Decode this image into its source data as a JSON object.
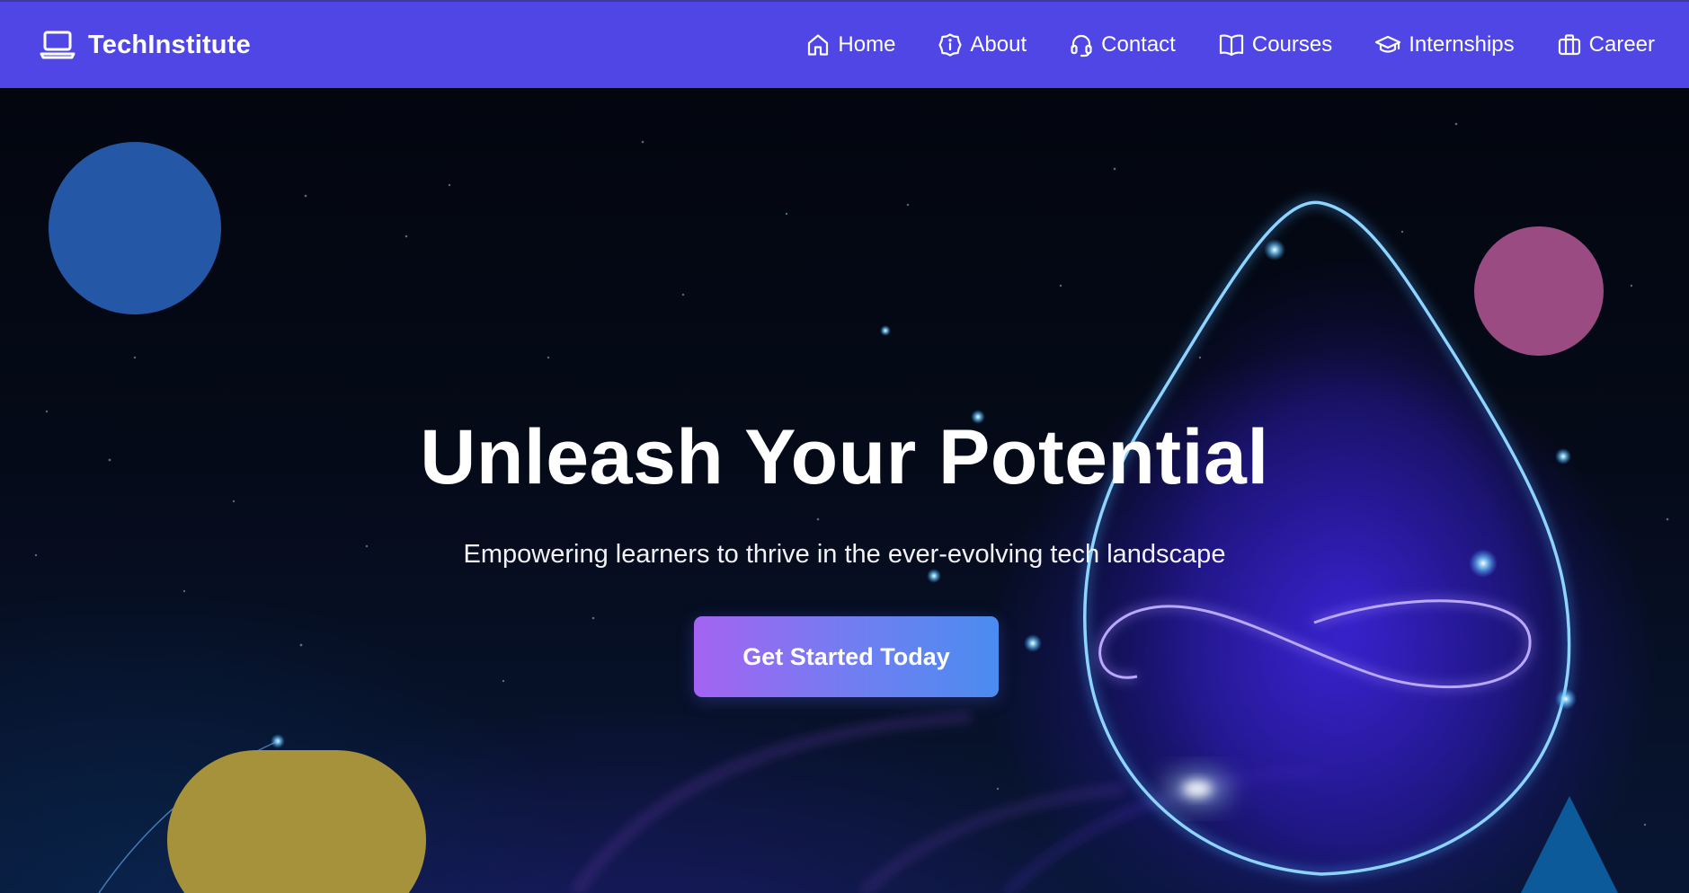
{
  "brand": {
    "name": "TechInstitute",
    "icon": "laptop-icon"
  },
  "nav": {
    "items": [
      {
        "label": "Home",
        "icon": "home-icon"
      },
      {
        "label": "About",
        "icon": "info-icon"
      },
      {
        "label": "Contact",
        "icon": "headset-icon"
      },
      {
        "label": "Courses",
        "icon": "book-icon"
      },
      {
        "label": "Internships",
        "icon": "graduation-cap-icon"
      },
      {
        "label": "Career",
        "icon": "briefcase-icon"
      }
    ]
  },
  "hero": {
    "title": "Unleash Your Potential",
    "subtitle": "Empowering learners to thrive in the ever-evolving tech landscape",
    "cta_label": "Get Started Today"
  },
  "colors": {
    "navbar": "#4f46e5",
    "cta_start": "#a463f2",
    "cta_end": "#4b8cf0",
    "circle_blue": "#2457a6",
    "circle_pink": "#9a4c82",
    "pill_yellow": "#a5923b",
    "triangle_teal": "#0d5a9a"
  }
}
